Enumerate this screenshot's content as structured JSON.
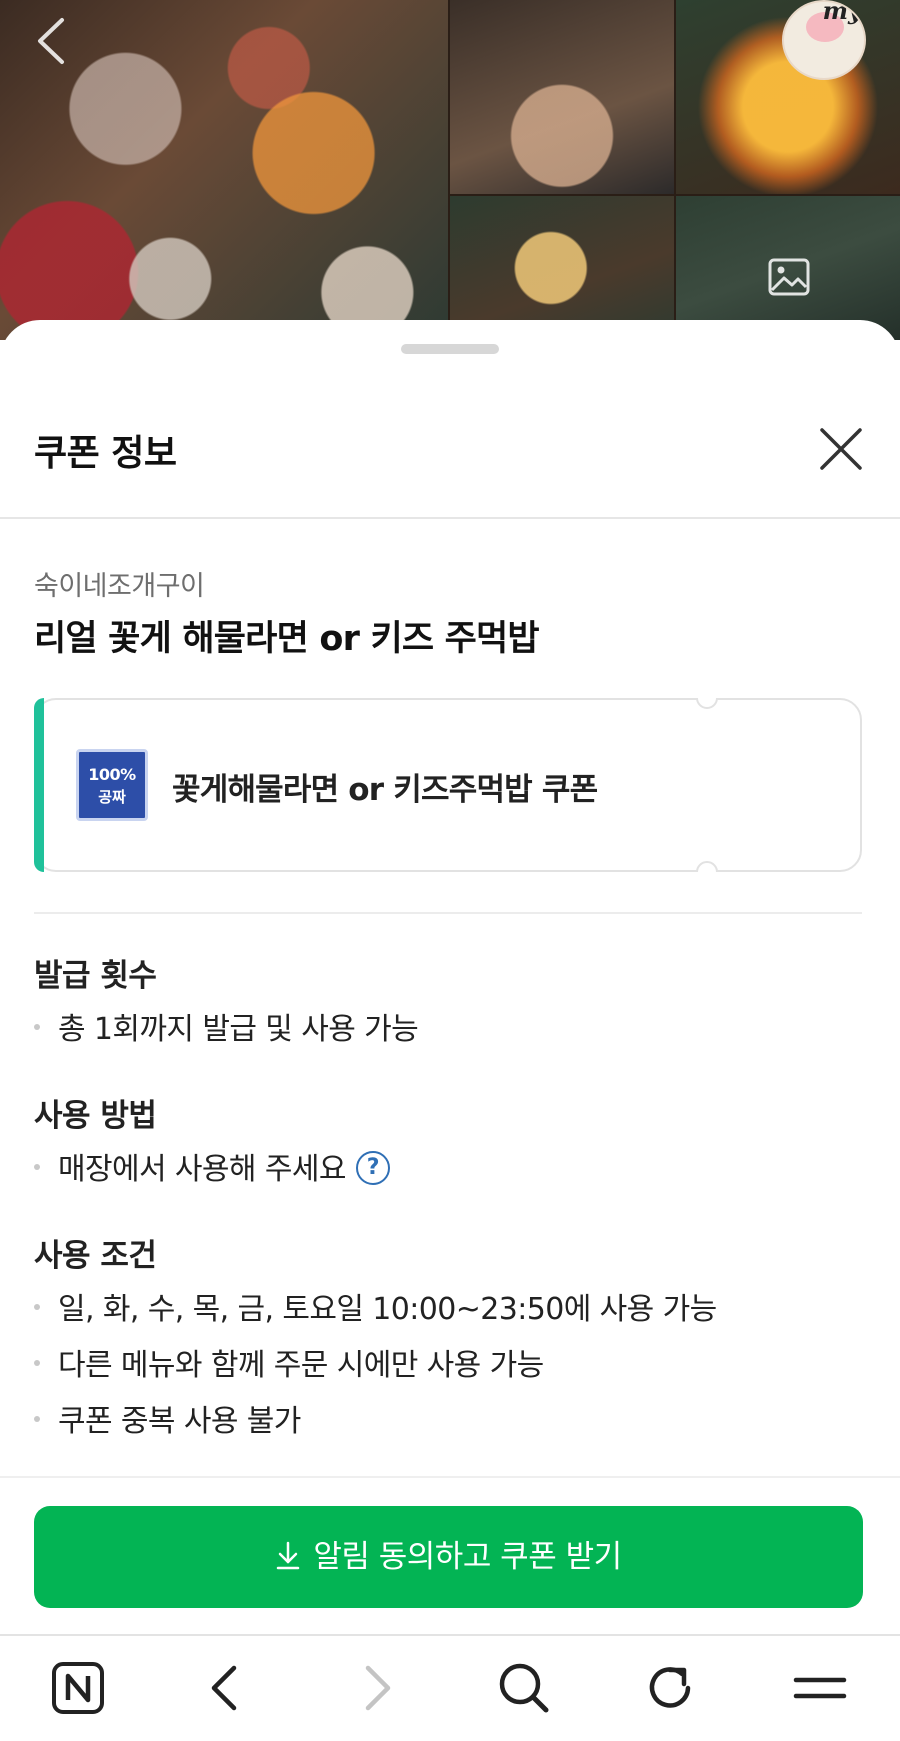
{
  "photos": {
    "sticker_text": "my"
  },
  "sheet": {
    "title": "쿠폰 정보",
    "store_name": "숙이네조개구이",
    "offer_title": "리얼 꽃게 해물라면 or 키즈 주먹밥"
  },
  "coupon": {
    "badge_line1": "100%",
    "badge_line2": "공짜",
    "name": "꽃게해물라면 or 키즈주먹밥 쿠폰",
    "accent_color": "#1fc19a"
  },
  "sections": {
    "issue": {
      "heading": "발급 횟수",
      "items": [
        "총 1회까지 발급 및 사용 가능"
      ]
    },
    "usage": {
      "heading": "사용 방법",
      "items": [
        "매장에서 사용해 주세요"
      ]
    },
    "conditions": {
      "heading": "사용 조건",
      "items": [
        "일, 화, 수, 목, 금, 토요일 10:00~23:50에 사용 가능",
        "다른 메뉴와 함께 주문 시에만 사용 가능",
        "쿠폰 중복 사용 불가"
      ]
    }
  },
  "cta": {
    "label": "알림 동의하고 쿠폰 받기",
    "color": "#03b454"
  },
  "toolbar": {
    "icons": [
      "naver-home-icon",
      "back-icon",
      "forward-icon",
      "search-icon",
      "refresh-icon",
      "menu-icon"
    ]
  }
}
